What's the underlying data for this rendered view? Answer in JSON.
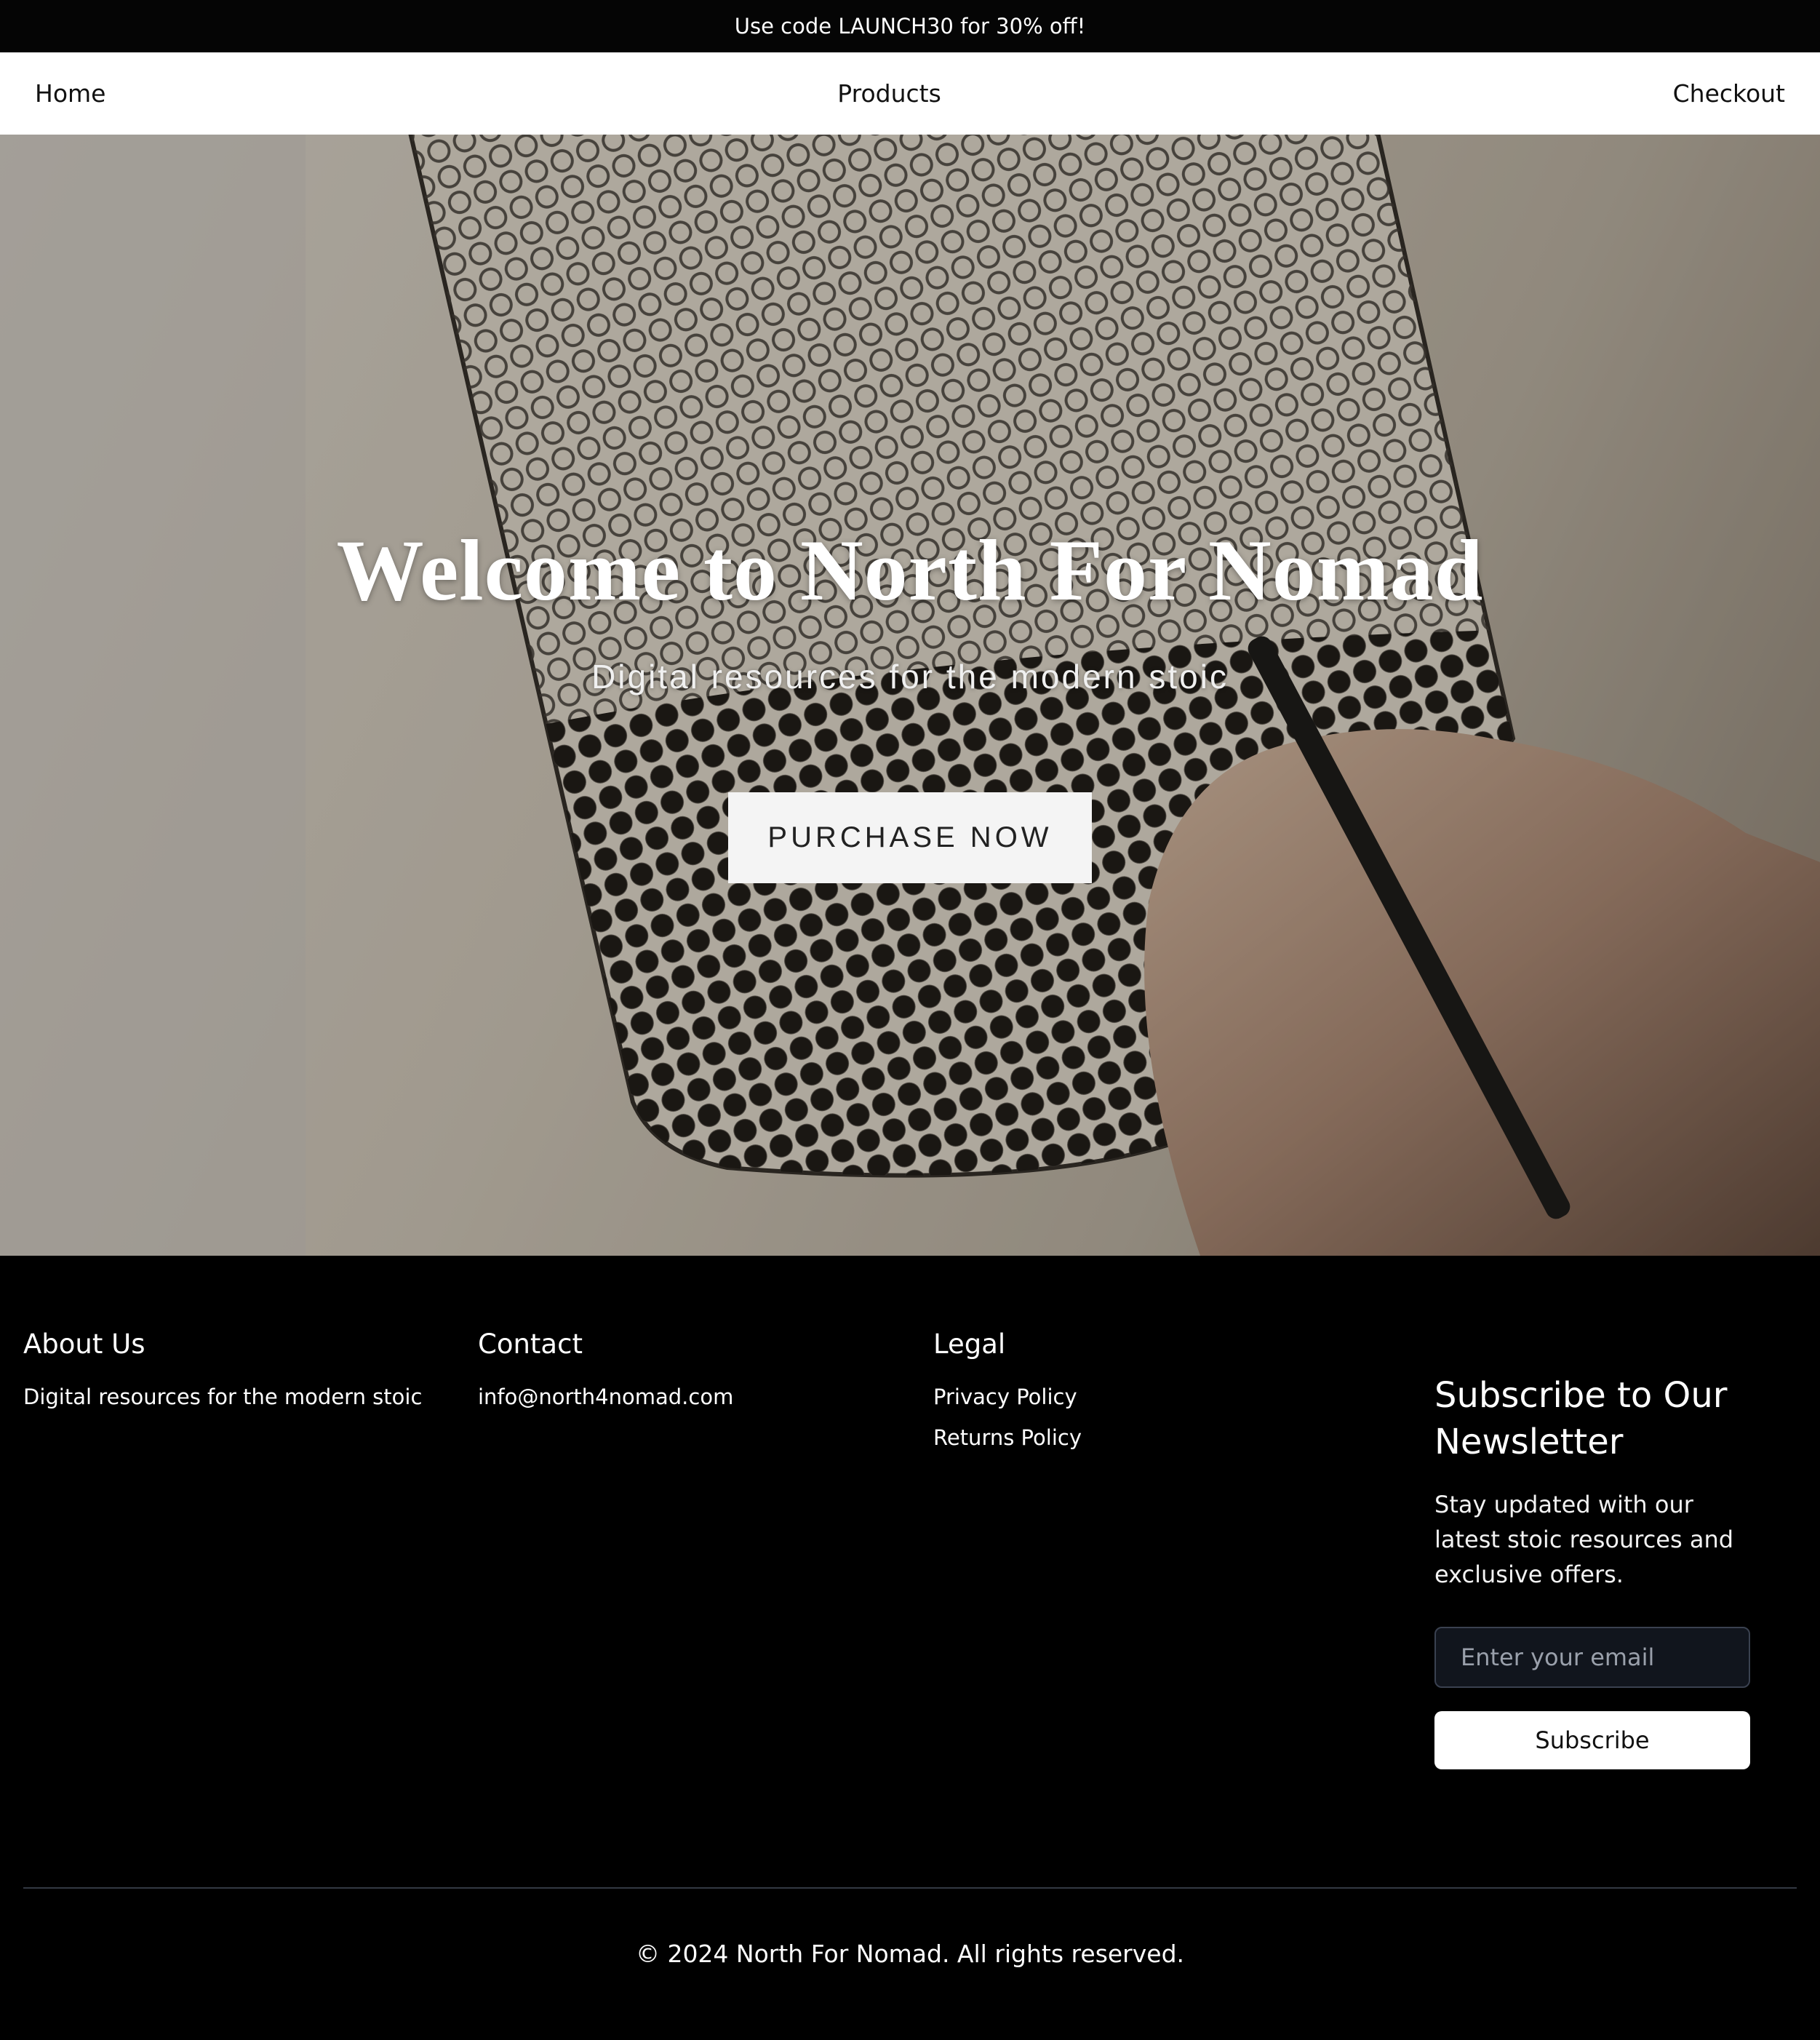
{
  "announcement": {
    "text": "Use code LAUNCH30 for 30% off!"
  },
  "nav": {
    "items": [
      {
        "label": "Home"
      },
      {
        "label": "Products"
      },
      {
        "label": "Checkout"
      }
    ]
  },
  "hero": {
    "title": "Welcome to North For Nomad",
    "subtitle": "Digital resources for the modern stoic",
    "cta_label": "PURCHASE NOW",
    "background_icon": "hand-drawing-dots-photo"
  },
  "footer": {
    "about": {
      "heading": "About Us",
      "text": "Digital resources for the modern stoic"
    },
    "contact": {
      "heading": "Contact",
      "email": "info@north4nomad.com"
    },
    "legal": {
      "heading": "Legal",
      "links": [
        {
          "label": "Privacy Policy"
        },
        {
          "label": "Returns Policy"
        }
      ]
    },
    "newsletter": {
      "heading": "Subscribe to Our Newsletter",
      "text": "Stay updated with our latest stoic resources and exclusive offers.",
      "email_placeholder": "Enter your email",
      "button_label": "Subscribe"
    },
    "copyright": "© 2024 North For Nomad. All rights reserved."
  },
  "colors": {
    "announcement_bg": "#050505",
    "nav_bg": "#ffffff",
    "footer_bg": "#000000",
    "cta_bg": "#f4f4f4"
  }
}
